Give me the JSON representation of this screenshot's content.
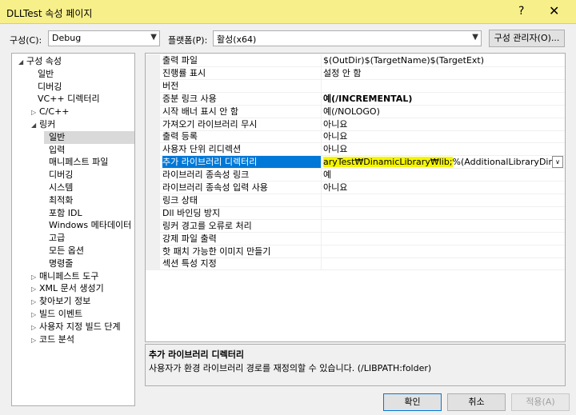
{
  "window": {
    "title": "DLLTest 속성 페이지",
    "help": "?",
    "close": "✕"
  },
  "config": {
    "config_label": "구성(C):",
    "config_value": "Debug",
    "platform_label": "플랫폼(P):",
    "platform_value": "활성(x64)",
    "manager_button": "구성 관리자(O)..."
  },
  "tree": [
    {
      "label": "구성 속성",
      "level": 0,
      "expander": "◢"
    },
    {
      "label": "일반",
      "level": 1,
      "expander": ""
    },
    {
      "label": "디버깅",
      "level": 1,
      "expander": ""
    },
    {
      "label": "VC++ 디렉터리",
      "level": 1,
      "expander": ""
    },
    {
      "label": "C/C++",
      "level": 1,
      "expander": "▷"
    },
    {
      "label": "링커",
      "level": 1,
      "expander": "◢"
    },
    {
      "label": "일반",
      "level": 2,
      "expander": "",
      "selected": true
    },
    {
      "label": "입력",
      "level": 2,
      "expander": ""
    },
    {
      "label": "매니페스트 파일",
      "level": 2,
      "expander": ""
    },
    {
      "label": "디버깅",
      "level": 2,
      "expander": ""
    },
    {
      "label": "시스템",
      "level": 2,
      "expander": ""
    },
    {
      "label": "최적화",
      "level": 2,
      "expander": ""
    },
    {
      "label": "포함 IDL",
      "level": 2,
      "expander": ""
    },
    {
      "label": "Windows 메타데이터",
      "level": 2,
      "expander": ""
    },
    {
      "label": "고급",
      "level": 2,
      "expander": ""
    },
    {
      "label": "모든 옵션",
      "level": 2,
      "expander": ""
    },
    {
      "label": "명령줄",
      "level": 2,
      "expander": ""
    },
    {
      "label": "매니페스트 도구",
      "level": 1,
      "expander": "▷"
    },
    {
      "label": "XML 문서 생성기",
      "level": 1,
      "expander": "▷"
    },
    {
      "label": "찾아보기 정보",
      "level": 1,
      "expander": "▷"
    },
    {
      "label": "빌드 이벤트",
      "level": 1,
      "expander": "▷"
    },
    {
      "label": "사용자 지정 빌드 단계",
      "level": 1,
      "expander": "▷"
    },
    {
      "label": "코드 분석",
      "level": 1,
      "expander": "▷"
    }
  ],
  "properties": [
    {
      "name": "출력 파일",
      "value": "$(OutDir)$(TargetName)$(TargetExt)"
    },
    {
      "name": "진행률 표시",
      "value": "설정 안 함"
    },
    {
      "name": "버전",
      "value": ""
    },
    {
      "name": "증분 링크 사용",
      "value": "예(/INCREMENTAL)",
      "bold": true
    },
    {
      "name": "시작 배너 표시 안 함",
      "value": "예(/NOLOGO)"
    },
    {
      "name": "가져오기 라이브러리 무시",
      "value": "아니요"
    },
    {
      "name": "출력 등록",
      "value": "아니요"
    },
    {
      "name": "사용자 단위 리디렉션",
      "value": "아니요"
    },
    {
      "name": "추가 라이브러리 디렉터리",
      "value_highlight": "aryTest₩DinamicLibrary₩lib;",
      "value": "%(AdditionalLibraryDirectories)",
      "selected": true,
      "dropdown": "∨"
    },
    {
      "name": "라이브러리 종속성 링크",
      "value": "예"
    },
    {
      "name": "라이브러리 종속성 입력 사용",
      "value": "아니요"
    },
    {
      "name": "링크 상태",
      "value": ""
    },
    {
      "name": "Dll 바인딩 방지",
      "value": ""
    },
    {
      "name": "링커 경고를 오류로 처리",
      "value": ""
    },
    {
      "name": "강제 파일 출력",
      "value": ""
    },
    {
      "name": "핫 패치 가능한 이미지 만들기",
      "value": ""
    },
    {
      "name": "섹션 특성 지정",
      "value": ""
    }
  ],
  "description": {
    "title": "추가 라이브러리 디렉터리",
    "text": "사용자가 환경 라이브러리 경로를 재정의할 수 있습니다. (/LIBPATH:folder)"
  },
  "buttons": {
    "ok": "확인",
    "cancel": "취소",
    "apply": "적용(A)"
  },
  "colors": {
    "titlebar": "#f7f08a",
    "selection": "#0078d7",
    "highlight": "#f5f500"
  }
}
